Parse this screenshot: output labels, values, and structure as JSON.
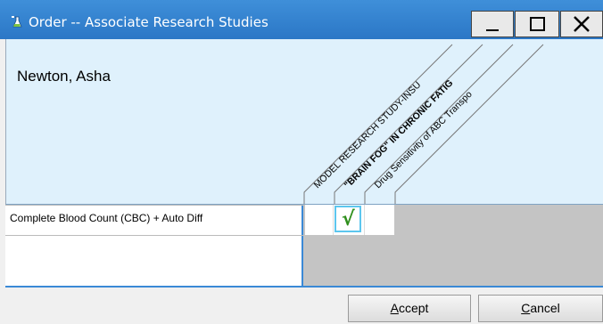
{
  "window": {
    "title": "Order -- Associate Research Studies",
    "icon": "flask-icon",
    "controls": [
      "minimize-icon",
      "maximize-icon",
      "close-icon"
    ]
  },
  "header": {
    "patient_name": "Newton, Asha",
    "study_columns": [
      {
        "label": "MODEL RESEARCH STUDY-INSU",
        "bold": false
      },
      {
        "label": "\"BRAIN FOG\" IN CHRONIC FATIG",
        "bold": true
      },
      {
        "label": "Drug Sensitivity of ABC Transpo",
        "bold": false
      }
    ]
  },
  "rows": [
    {
      "label": "Complete Blood Count (CBC) + Auto Diff",
      "checked": [
        false,
        true,
        false
      ]
    }
  ],
  "footer": {
    "accept_key": "A",
    "accept_rest": "ccept",
    "cancel_key": "C",
    "cancel_rest": "ancel"
  },
  "colors": {
    "title_bar": "#2b77c6",
    "header_bg": "#dff1fc",
    "accent_line": "#3a89d6",
    "check": "#2f8f1c",
    "selection_border": "#5cc6ee"
  }
}
